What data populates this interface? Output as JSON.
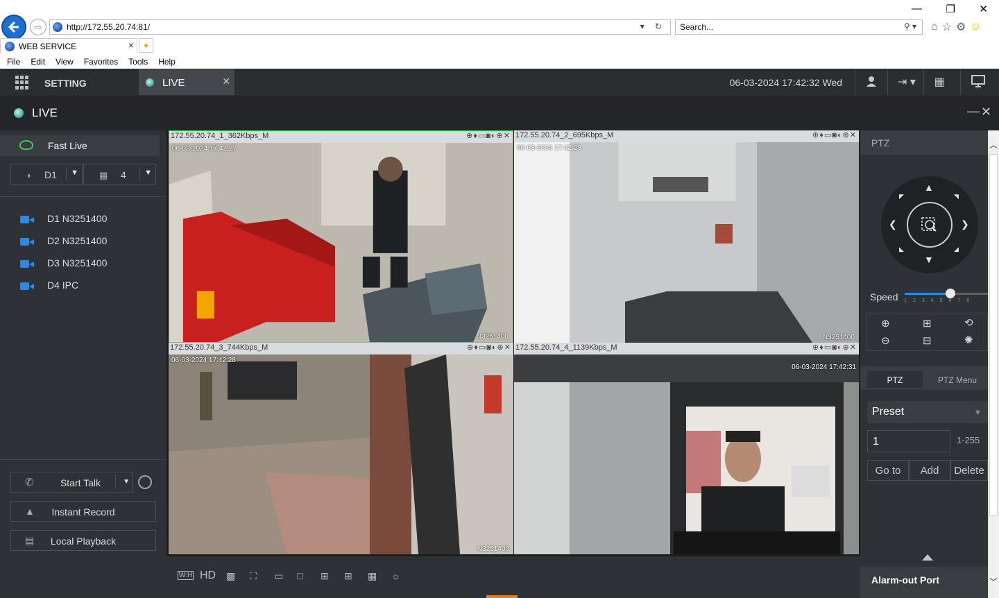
{
  "browser": {
    "url": "http://172.55.20.74:81/",
    "search_placeholder": "Search...",
    "tab_title": "WEB SERVICE",
    "menu": [
      "File",
      "Edit",
      "View",
      "Favorites",
      "Tools",
      "Help"
    ]
  },
  "app": {
    "setting_label": "SETTING",
    "live_tab_label": "LIVE",
    "datetime": "06-03-2024 17:42:32 Wed",
    "live_title": "LIVE"
  },
  "left": {
    "fast_live": "Fast Live",
    "stream_select": "D1",
    "layout_select": "4",
    "cameras": [
      "D1 N3251400",
      "D2 N3251400",
      "D3 N3251400",
      "D4 IPC"
    ],
    "start_talk": "Start Talk",
    "instant_record": "Instant Record",
    "local_playback": "Local Playback"
  },
  "panes": [
    {
      "header": "172.55.20.74_1_362Kbps_M",
      "osd_time": "06-03-2024 17:42:27",
      "osd_name": "N3251400"
    },
    {
      "header": "172.55.20.74_2_695Kbps_M",
      "osd_time": "06-03-2024 17:42:28",
      "osd_name": "N3251400"
    },
    {
      "header": "172.55.20.74_3_744Kbps_M",
      "osd_time": "06-03-2024 17:42:28",
      "osd_name": "N3251400"
    },
    {
      "header": "172.55.20.74_4_1139Kbps_M",
      "osd_time": "06-03-2024 17:42:31",
      "osd_name": ""
    }
  ],
  "toolbar": {
    "hd_label": "HD",
    "wh_label": "W:H"
  },
  "ptz": {
    "title": "PTZ",
    "speed_label": "Speed",
    "speed_ticks": "12345678",
    "speed_level": 5,
    "speed_max": 8,
    "tab_ptz": "PTZ",
    "tab_menu": "PTZ Menu",
    "preset_label": "Preset",
    "preset_value": "1",
    "preset_range": "1-255",
    "goto": "Go to",
    "add": "Add",
    "delete": "Delete",
    "alarm_out": "Alarm-out Port"
  },
  "colors": {
    "accent_green": "#3fe03f",
    "camera_blue": "#1f8ef0",
    "toolbar_accent": "#e47b1e"
  }
}
